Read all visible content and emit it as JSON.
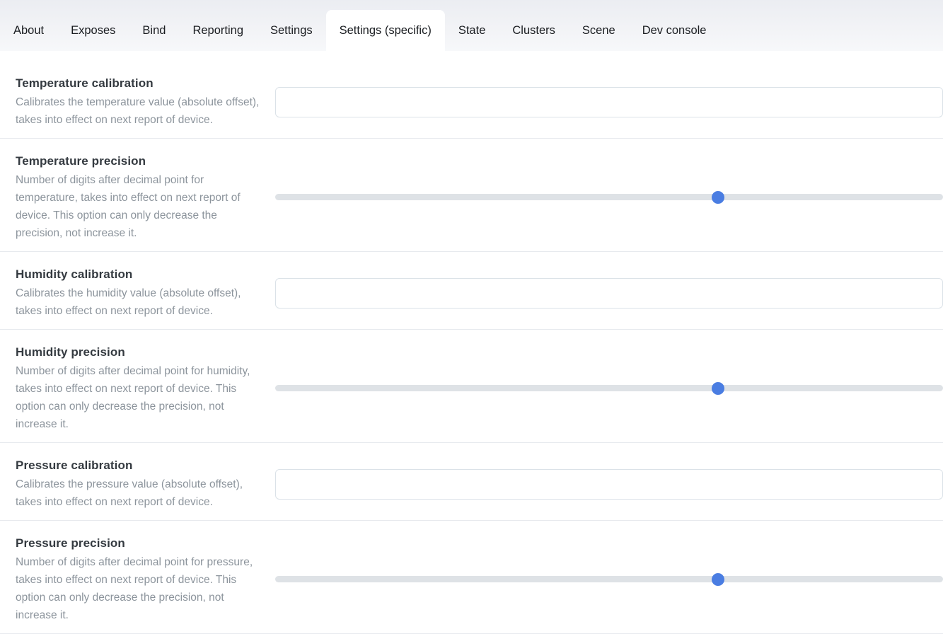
{
  "tabs": {
    "items": [
      {
        "label": "About",
        "active": false
      },
      {
        "label": "Exposes",
        "active": false
      },
      {
        "label": "Bind",
        "active": false
      },
      {
        "label": "Reporting",
        "active": false
      },
      {
        "label": "Settings",
        "active": false
      },
      {
        "label": "Settings (specific)",
        "active": true
      },
      {
        "label": "State",
        "active": false
      },
      {
        "label": "Clusters",
        "active": false
      },
      {
        "label": "Scene",
        "active": false
      },
      {
        "label": "Dev console",
        "active": false
      }
    ]
  },
  "settings": {
    "rows": [
      {
        "title": "Temperature calibration",
        "description": "Calibrates the temperature value (absolute offset), takes into effect on next report of device.",
        "control": {
          "type": "text",
          "value": "",
          "placeholder": ""
        }
      },
      {
        "title": "Temperature precision",
        "description": "Number of digits after decimal point for temperature, takes into effect on next report of device. This option can only decrease the precision, not increase it.",
        "control": {
          "type": "slider",
          "value": 2,
          "min": 0,
          "max": 3
        }
      },
      {
        "title": "Humidity calibration",
        "description": "Calibrates the humidity value (absolute offset), takes into effect on next report of device.",
        "control": {
          "type": "text",
          "value": "",
          "placeholder": ""
        }
      },
      {
        "title": "Humidity precision",
        "description": "Number of digits after decimal point for humidity, takes into effect on next report of device. This option can only decrease the precision, not increase it.",
        "control": {
          "type": "slider",
          "value": 2,
          "min": 0,
          "max": 3
        }
      },
      {
        "title": "Pressure calibration",
        "description": "Calibrates the pressure value (absolute offset), takes into effect on next report of device.",
        "control": {
          "type": "text",
          "value": "",
          "placeholder": ""
        }
      },
      {
        "title": "Pressure precision",
        "description": "Number of digits after decimal point for pressure, takes into effect on next report of device. This option can only decrease the precision, not increase it.",
        "control": {
          "type": "slider",
          "value": 2,
          "min": 0,
          "max": 3
        }
      }
    ]
  },
  "colors": {
    "accent": "#4a7de2",
    "slider_track": "#dee2e6",
    "tab_active_bg": "#ffffff"
  }
}
